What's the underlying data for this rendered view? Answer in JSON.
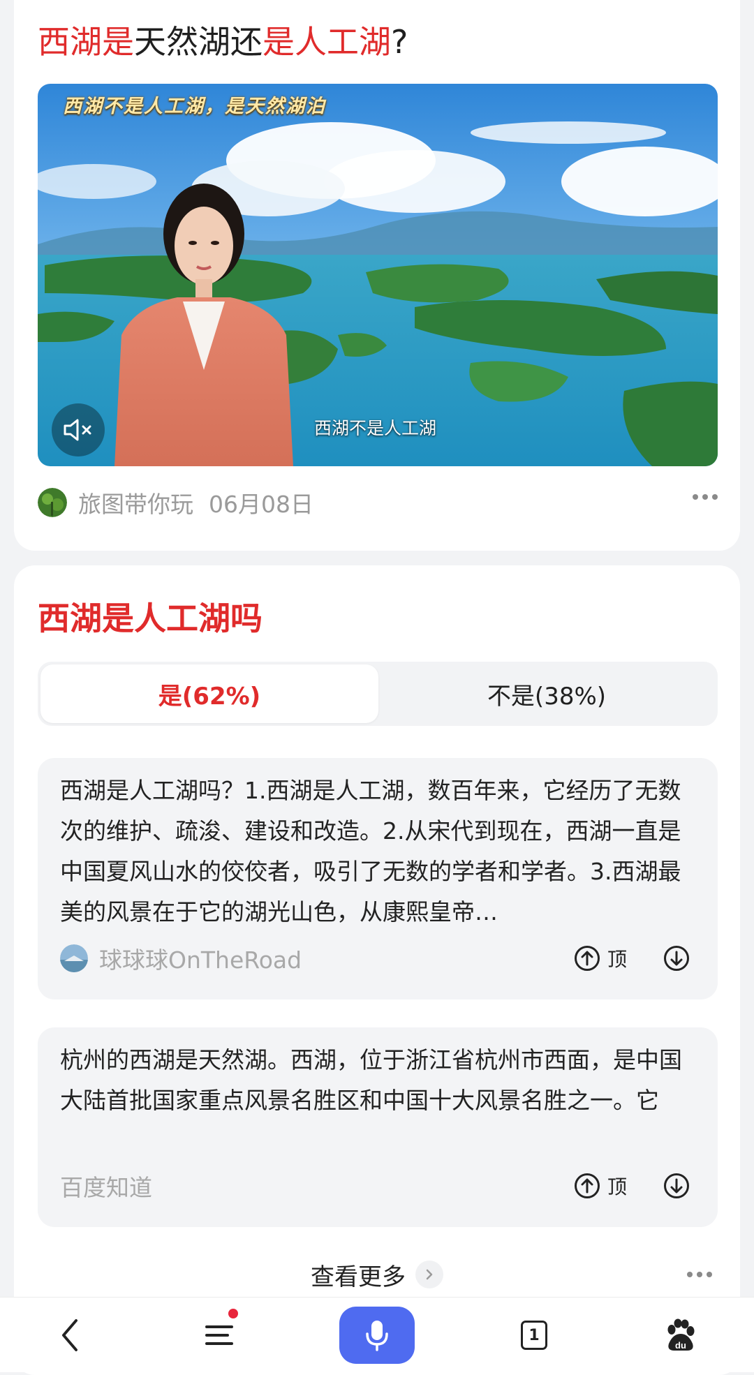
{
  "video_card": {
    "title_parts": {
      "p1": "西湖是",
      "p2": "天然湖还",
      "p3": "是人工湖",
      "p4": "?"
    },
    "video": {
      "caption_top": "西湖不是人工湖，是天然湖泊",
      "subtitle": "西湖不是人工湖",
      "muted": true
    },
    "author": "旅图带你玩",
    "date": "06月08日"
  },
  "poll_card": {
    "title": "西湖是人工湖吗",
    "tabs": [
      {
        "label": "是(62%)",
        "selected": true
      },
      {
        "label": "不是(38%)",
        "selected": false
      }
    ],
    "answers": [
      {
        "text": "西湖是人工湖吗？1.西湖是人工湖，数百年来，它经历了无数次的维护、疏浚、建设和改造。2.从宋代到现在，西湖一直是中国夏风山水的佼佼者，吸引了无数的学者和学者。3.西湖最美的风景在于它的湖光山色，从康熙皇帝…",
        "source": "球球球OnTheRoad",
        "upvote_label": "顶"
      },
      {
        "text": "杭州的西湖是天然湖。西湖，位于浙江省杭州市西面，是中国大陆首批国家重点风景名胜区和中国十大风景名胜之一。它",
        "source": "百度知道",
        "upvote_label": "顶"
      }
    ],
    "see_more": "查看更多"
  },
  "bottom_nav": {
    "tab_count": "1",
    "has_notification": true
  },
  "colors": {
    "accent_red": "#e02b2b",
    "voice_blue": "#4f6bf0",
    "notification_red": "#e8253b"
  }
}
